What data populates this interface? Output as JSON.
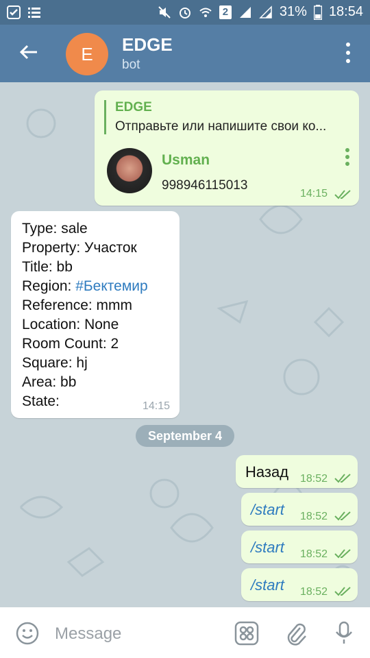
{
  "status": {
    "battery_text": "31%",
    "clock": "18:54",
    "sim_badge": "2"
  },
  "header": {
    "avatar_letter": "E",
    "title": "EDGE",
    "subtitle": "bot"
  },
  "messages": {
    "reply_card": {
      "reply_name": "EDGE",
      "reply_text": "Отправьте или напишите свои ко...",
      "contact_name": "Usman",
      "contact_phone": "998946115013",
      "time": "14:15"
    },
    "info": {
      "lines": [
        "Type: sale",
        "Property: Участок",
        "Title: bb",
        "Region: ",
        "Reference: mmm",
        "Location: None",
        "Room Count: 2",
        "Square: hj",
        "Area: bb",
        "State:"
      ],
      "region_hashtag": "#Бектемир",
      "time": "14:15"
    },
    "date_separator": "September 4",
    "outgoing": [
      {
        "text": "Назад",
        "time": "18:52"
      },
      {
        "text": "/start",
        "time": "18:52"
      },
      {
        "text": "/start",
        "time": "18:52"
      },
      {
        "text": "/start",
        "time": "18:52"
      }
    ]
  },
  "composer": {
    "placeholder": "Message"
  },
  "colors": {
    "header": "#557ea5",
    "statusbar": "#4a6f8f",
    "accent_green": "#62b04f",
    "link_blue": "#2e7bbf",
    "outgoing_bubble": "#effdde"
  }
}
